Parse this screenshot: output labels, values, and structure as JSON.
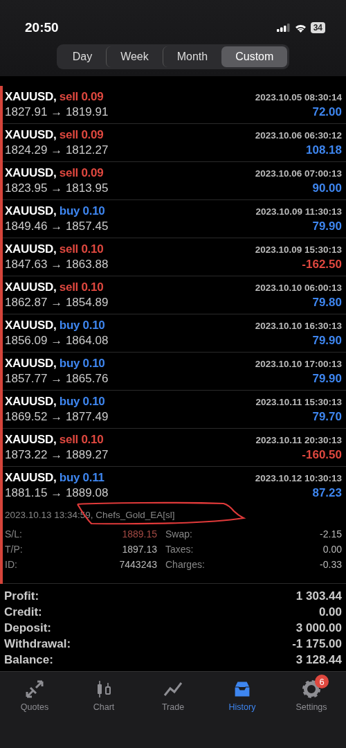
{
  "status_bar": {
    "time": "20:50",
    "battery": "34"
  },
  "periods": [
    {
      "label": "Day",
      "selected": false
    },
    {
      "label": "Week",
      "selected": false
    },
    {
      "label": "Month",
      "selected": false
    },
    {
      "label": "Custom",
      "selected": true
    }
  ],
  "deals": [
    {
      "symbol": "XAUUSD,",
      "side": "sell",
      "volume": "0.09",
      "prices": "1827.91 → 1819.91",
      "time": "2023.10.05 08:30:14",
      "profit": "72.00"
    },
    {
      "symbol": "XAUUSD,",
      "side": "sell",
      "volume": "0.09",
      "prices": "1824.29 → 1812.27",
      "time": "2023.10.06 06:30:12",
      "profit": "108.18"
    },
    {
      "symbol": "XAUUSD,",
      "side": "sell",
      "volume": "0.09",
      "prices": "1823.95 → 1813.95",
      "time": "2023.10.06 07:00:13",
      "profit": "90.00"
    },
    {
      "symbol": "XAUUSD,",
      "side": "buy",
      "volume": "0.10",
      "prices": "1849.46 → 1857.45",
      "time": "2023.10.09 11:30:13",
      "profit": "79.90"
    },
    {
      "symbol": "XAUUSD,",
      "side": "sell",
      "volume": "0.10",
      "prices": "1847.63 → 1863.88",
      "time": "2023.10.09 15:30:13",
      "profit": "-162.50"
    },
    {
      "symbol": "XAUUSD,",
      "side": "sell",
      "volume": "0.10",
      "prices": "1862.87 → 1854.89",
      "time": "2023.10.10 06:00:13",
      "profit": "79.80"
    },
    {
      "symbol": "XAUUSD,",
      "side": "buy",
      "volume": "0.10",
      "prices": "1856.09 → 1864.08",
      "time": "2023.10.10 16:30:13",
      "profit": "79.90"
    },
    {
      "symbol": "XAUUSD,",
      "side": "buy",
      "volume": "0.10",
      "prices": "1857.77 → 1865.76",
      "time": "2023.10.10 17:00:13",
      "profit": "79.90"
    },
    {
      "symbol": "XAUUSD,",
      "side": "buy",
      "volume": "0.10",
      "prices": "1869.52 → 1877.49",
      "time": "2023.10.11 15:30:13",
      "profit": "79.70"
    },
    {
      "symbol": "XAUUSD,",
      "side": "sell",
      "volume": "0.10",
      "prices": "1873.22 → 1889.27",
      "time": "2023.10.11 20:30:13",
      "profit": "-160.50"
    }
  ],
  "expanded_deal": {
    "symbol": "XAUUSD,",
    "side": "buy",
    "volume": "0.11",
    "prices": "1881.15 → 1889.08",
    "time": "2023.10.12 10:30:13",
    "profit": "87.23",
    "comment": "2023.10.13 13:34:59, Chefs_Gold_EA[sl]",
    "details": [
      {
        "label": "S/L:",
        "value": "1889.15",
        "label2": "Swap:",
        "value2": "-2.15"
      },
      {
        "label": "T/P:",
        "value": "1897.13",
        "label2": "Taxes:",
        "value2": "0.00"
      },
      {
        "label": "ID:",
        "value": "7443243",
        "label2": "Charges:",
        "value2": "-0.33"
      }
    ]
  },
  "summary": [
    {
      "label": "Profit:",
      "value": "1 303.44"
    },
    {
      "label": "Credit:",
      "value": "0.00"
    },
    {
      "label": "Deposit:",
      "value": "3 000.00"
    },
    {
      "label": "Withdrawal:",
      "value": "-1 175.00"
    },
    {
      "label": "Balance:",
      "value": "3 128.44"
    }
  ],
  "tab_bar": [
    {
      "label": "Quotes",
      "kind": "quotes",
      "selected": false
    },
    {
      "label": "Chart",
      "kind": "chart",
      "selected": false
    },
    {
      "label": "Trade",
      "kind": "trade",
      "selected": false
    },
    {
      "label": "History",
      "kind": "history",
      "selected": true
    },
    {
      "label": "Settings",
      "kind": "settings",
      "selected": false,
      "badge": "6"
    }
  ]
}
